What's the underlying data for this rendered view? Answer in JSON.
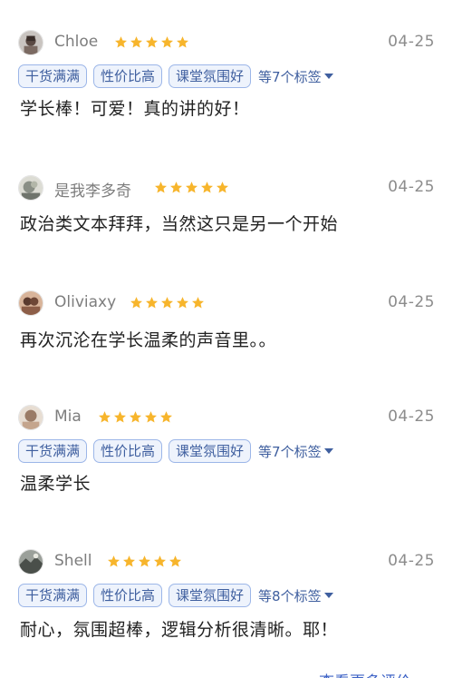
{
  "reviews": [
    {
      "name": "Chloe",
      "rating": 5,
      "date": "04-25",
      "tags": [
        "干货满满",
        "性价比高",
        "课堂氛围好"
      ],
      "more_tags": "等7个标签",
      "text": "学长棒！可爱！真的讲的好！"
    },
    {
      "name": "是我李多奇",
      "rating": 5,
      "date": "04-25",
      "tags": [],
      "more_tags": "",
      "text": "政治类文本拜拜，当然这只是另一个开始"
    },
    {
      "name": "Oliviaxy",
      "rating": 5,
      "date": "04-25",
      "tags": [],
      "more_tags": "",
      "text": "再次沉沦在学长温柔的声音里。。"
    },
    {
      "name": "Mia",
      "rating": 5,
      "date": "04-25",
      "tags": [
        "干货满满",
        "性价比高",
        "课堂氛围好"
      ],
      "more_tags": "等7个标签",
      "text": "温柔学长"
    },
    {
      "name": "Shell",
      "rating": 5,
      "date": "04-25",
      "tags": [
        "干货满满",
        "性价比高",
        "课堂氛围好"
      ],
      "more_tags": "等8个标签",
      "text": "耐心，氛围超棒，逻辑分析很清晰。耶！"
    }
  ],
  "footer": {
    "more_reviews": "查看更多评价"
  },
  "colors": {
    "star": "#f7b52c",
    "tag_border": "#9cb6e8",
    "tag_text": "#3f5f9f",
    "link": "#3e63c6"
  },
  "icons": {
    "star": "star-icon",
    "dropdown": "caret-down-icon"
  }
}
